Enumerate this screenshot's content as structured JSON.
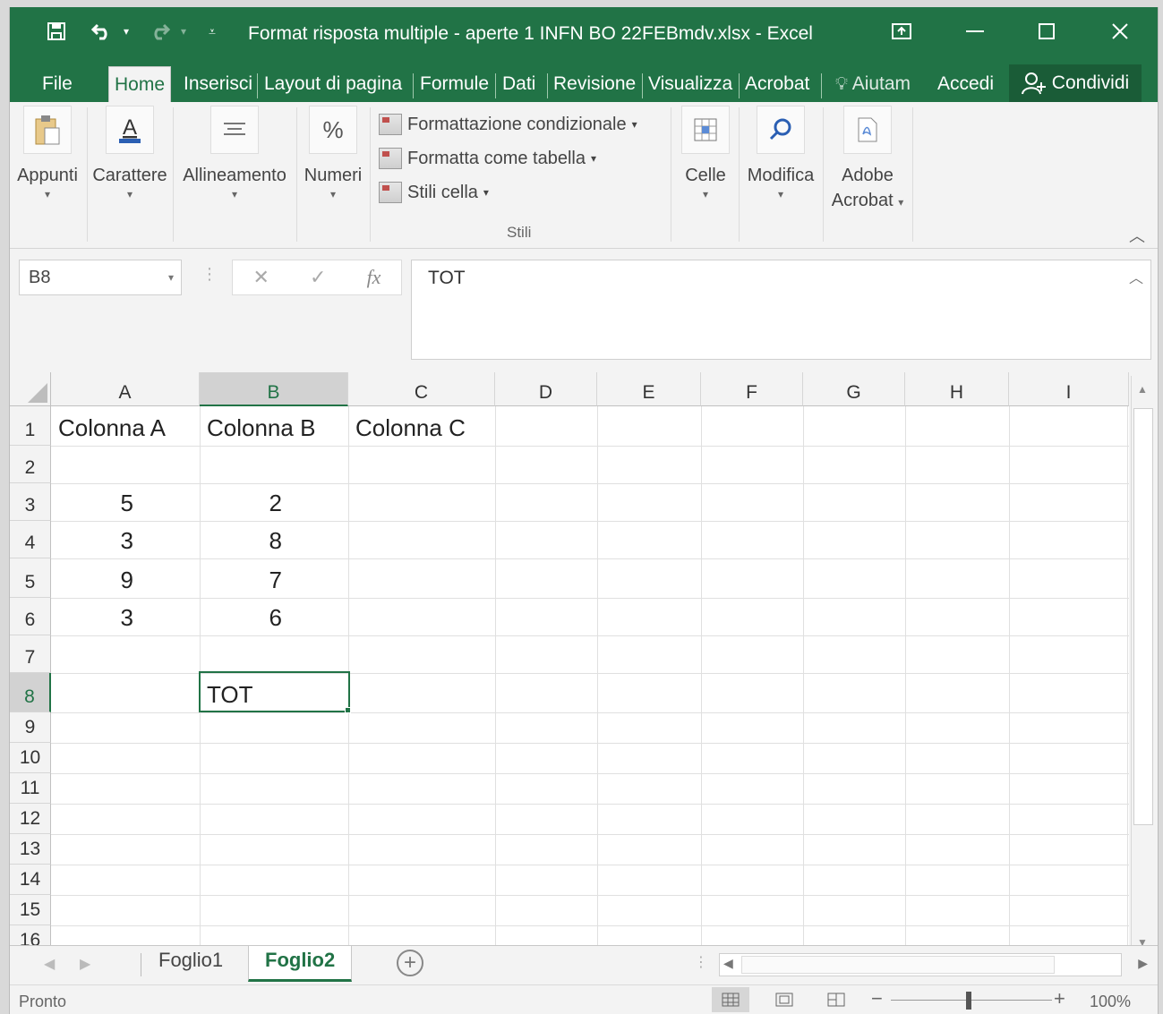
{
  "window": {
    "title": "Format risposta multiple - aperte 1 INFN BO 22FEBmdv.xlsx  -  Excel"
  },
  "ribbon_tabs": [
    "File",
    "Home",
    "Inserisci",
    "Layout di pagina",
    "Formule",
    "Dati",
    "Revisione",
    "Visualizza",
    "Acrobat"
  ],
  "tell_me": "Aiutam",
  "sign_in": "Accedi",
  "share": "Condividi",
  "ribbon": {
    "groups": {
      "appunti": "Appunti",
      "carattere": "Carattere",
      "allineamento": "Allineamento",
      "numeri": "Numeri",
      "celle": "Celle",
      "modifica": "Modifica",
      "adobe_line1": "Adobe",
      "adobe_line2": "Acrobat"
    },
    "styles": {
      "conditional": "Formattazione condizionale",
      "table": "Formatta come tabella",
      "cell_styles": "Stili cella",
      "group_label": "Stili"
    }
  },
  "formula_bar": {
    "name_box": "B8",
    "fx": "fx",
    "content": "TOT"
  },
  "grid": {
    "columns": [
      "A",
      "B",
      "C",
      "D",
      "E",
      "F",
      "G",
      "H",
      "I"
    ],
    "rows": [
      "1",
      "2",
      "3",
      "4",
      "5",
      "6",
      "7",
      "8",
      "9",
      "10",
      "11",
      "12",
      "13",
      "14",
      "15",
      "16"
    ],
    "selected_cell": "B8",
    "cells": {
      "A1": "Colonna A",
      "B1": "Colonna B",
      "C1": "Colonna C",
      "A3": "5",
      "B3": "2",
      "A4": "3",
      "B4": "8",
      "A5": "9",
      "B5": "7",
      "A6": "3",
      "B6": "6",
      "B8": "TOT"
    }
  },
  "sheets": {
    "tabs": [
      "Foglio1",
      "Foglio2"
    ],
    "active": "Foglio2"
  },
  "status": {
    "text": "Pronto",
    "zoom": "100%"
  },
  "colors": {
    "brand": "#217346",
    "ribbon_bg": "#f3f3f3"
  }
}
